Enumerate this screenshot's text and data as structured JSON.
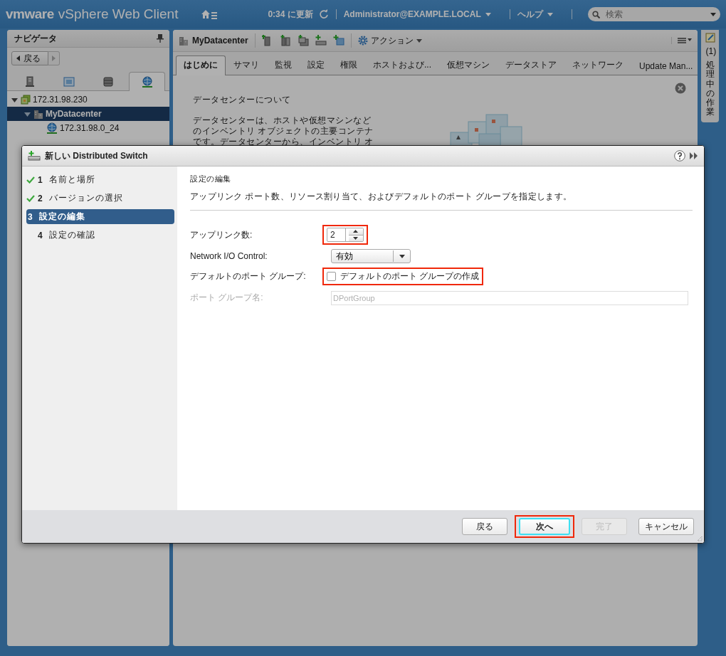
{
  "header": {
    "logo": "vmware",
    "product": "vSphere Web Client",
    "refresh": "0:34 に更新",
    "user": "Administrator@EXAMPLE.LOCAL",
    "help": "ヘルプ",
    "search": {
      "placeholder": "検索"
    }
  },
  "navigator": {
    "title": "ナビゲータ",
    "back": "戻る",
    "tabs": [
      {
        "kind": "hosts",
        "selected": false
      },
      {
        "kind": "vms",
        "selected": false
      },
      {
        "kind": "storage",
        "selected": false
      },
      {
        "kind": "network",
        "selected": true
      }
    ],
    "tree": [
      {
        "label": "172.31.98.230",
        "kind": "vcenter",
        "expanded": true,
        "selected": false,
        "children": [
          {
            "label": "MyDatacenter",
            "kind": "datacenter",
            "expanded": true,
            "selected": true,
            "children": [
              {
                "label": "172.31.98.0_24",
                "kind": "network",
                "selected": false
              }
            ]
          }
        ]
      }
    ]
  },
  "main": {
    "title": "MyDatacenter",
    "actions": "アクション",
    "tabs": [
      {
        "label": "はじめに",
        "selected": true
      },
      {
        "label": "サマリ",
        "selected": false
      },
      {
        "label": "監視",
        "selected": false
      },
      {
        "label": "設定",
        "selected": false
      },
      {
        "label": "権限",
        "selected": false
      },
      {
        "label": "ホストおよび...",
        "selected": false
      },
      {
        "label": "仮想マシン",
        "selected": false
      },
      {
        "label": "データストア",
        "selected": false
      },
      {
        "label": "ネットワーク",
        "selected": false
      },
      {
        "label": "Update Man...",
        "selected": false
      }
    ],
    "content": {
      "heading": "データセンターについて",
      "lines": [
        "データセンターは、ホストや仮想マシンなど",
        "のインベントリ オブジェクトの主要コンテナ",
        "です。データセンターから、インベントリ オ"
      ]
    }
  },
  "tasks": {
    "count": "(1)",
    "label": "処理中の作業"
  },
  "dialog": {
    "title": "新しい Distributed Switch",
    "steps": [
      {
        "number": "1",
        "label": "名前と場所",
        "completed": true,
        "selected": false
      },
      {
        "number": "2",
        "label": "バージョンの選択",
        "completed": true,
        "selected": false
      },
      {
        "number": "3",
        "label": "設定の編集",
        "completed": false,
        "selected": true
      },
      {
        "number": "4",
        "label": "設定の確認",
        "completed": false,
        "selected": false
      }
    ],
    "heading": "設定の編集",
    "description": "アップリンク ポート数、リソース割り当て、およびデフォルトのポート グループを指定します。",
    "fields": [
      {
        "kind": "spinner",
        "label": "アップリンク数:",
        "value": "2",
        "highlighted": true,
        "disabled": false
      },
      {
        "kind": "dropdown",
        "label": "Network I/O Control:",
        "value": "有効",
        "highlighted": false,
        "disabled": false
      },
      {
        "kind": "checkbox",
        "label": "デフォルトのポート グループ:",
        "text": "デフォルトのポート グループの作成",
        "checked": false,
        "highlighted": true,
        "disabled": false
      },
      {
        "kind": "text",
        "label": "ポート グループ名:",
        "value": "DPortGroup",
        "highlighted": false,
        "disabled": true
      }
    ],
    "buttons": [
      {
        "label": "戻る",
        "disabled": false,
        "focused": false,
        "highlighted": false
      },
      {
        "label": "次へ",
        "disabled": false,
        "focused": true,
        "highlighted": true
      },
      {
        "label": "完了",
        "disabled": true,
        "focused": false,
        "highlighted": false
      },
      {
        "label": "キャンセル",
        "disabled": false,
        "focused": false,
        "highlighted": false
      }
    ]
  }
}
